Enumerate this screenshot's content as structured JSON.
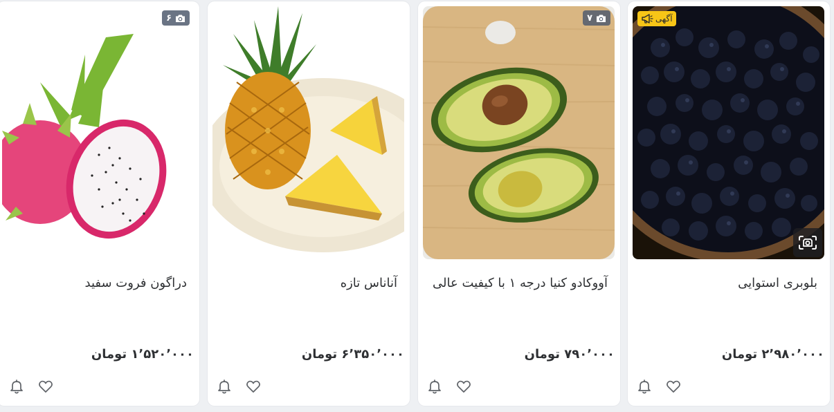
{
  "products": [
    {
      "title": "بلوبری استوایی",
      "price": "۲٬۹۸۰٬۰۰۰ تومان",
      "ad_label": "آگهی",
      "image": "blueberries-bowl"
    },
    {
      "title": "آووکادو کنیا درجه ۱ با کیفیت عالی",
      "price": "۷۹۰٬۰۰۰ تومان",
      "photo_count": "۷",
      "image": "avocado-board"
    },
    {
      "title": "آناناس تازه",
      "price": "۶٬۳۵۰٬۰۰۰ تومان",
      "image": "pineapple-plate"
    },
    {
      "title": "دراگون فروت سفید",
      "price": "۱٬۵۲۰٬۰۰۰ تومان",
      "photo_count": "۶",
      "image": "dragon-fruit"
    }
  ],
  "icons": {
    "camera": "camera-icon",
    "megaphone": "megaphone-icon",
    "visual_search": "visual-search-icon",
    "bell": "bell-icon",
    "heart": "heart-icon"
  },
  "colors": {
    "ad_badge": "#f7c517",
    "photo_badge": "#505c6e",
    "text": "#2e3033"
  }
}
